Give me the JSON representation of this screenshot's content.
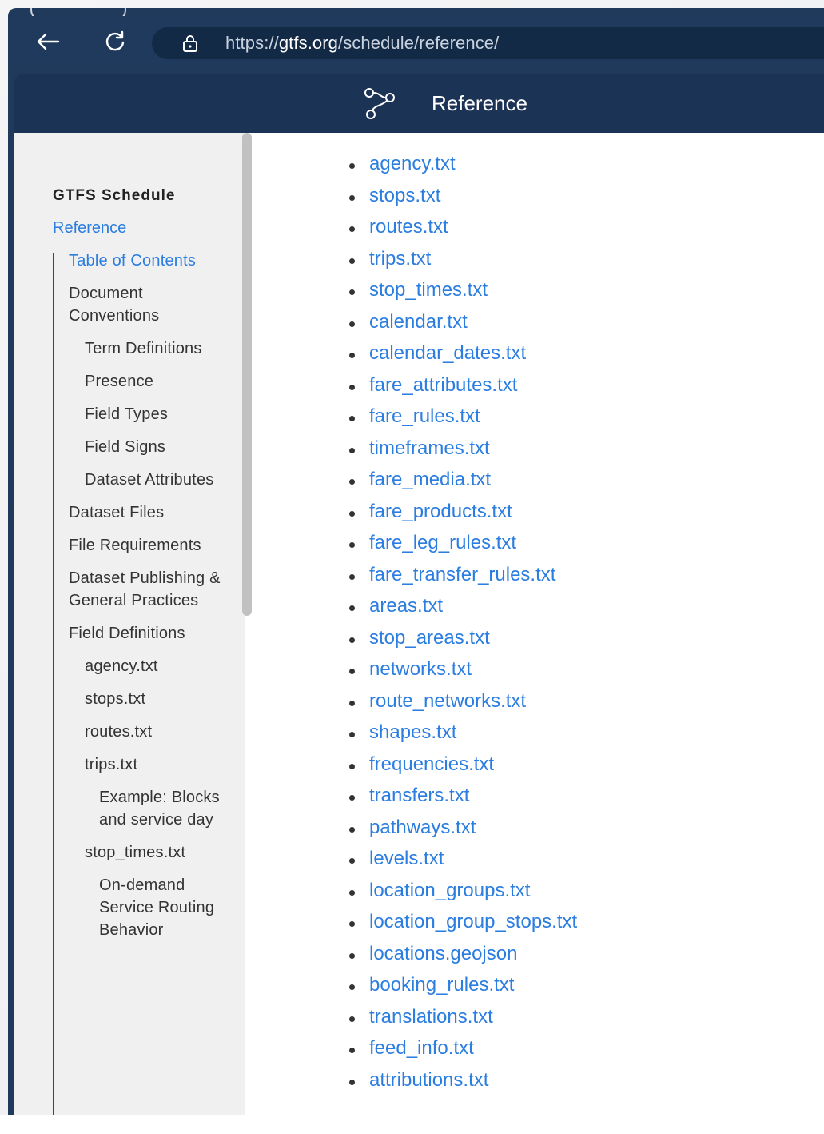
{
  "browser": {
    "url_prefix": "https://",
    "url_host": "gtfs.org",
    "url_path": "/schedule/reference/"
  },
  "header": {
    "title": "Reference"
  },
  "sidebar": {
    "heading": "GTFS Schedule",
    "reference_link": "Reference",
    "items": [
      {
        "label": "Table of Contents",
        "level": 1,
        "active": true
      },
      {
        "label": "Document Conventions",
        "level": 1
      },
      {
        "label": "Term Definitions",
        "level": 2
      },
      {
        "label": "Presence",
        "level": 2
      },
      {
        "label": "Field Types",
        "level": 2
      },
      {
        "label": "Field Signs",
        "level": 2
      },
      {
        "label": "Dataset Attributes",
        "level": 2
      },
      {
        "label": "Dataset Files",
        "level": 1
      },
      {
        "label": "File Requirements",
        "level": 1
      },
      {
        "label": "Dataset Publishing & General Practices",
        "level": 1
      },
      {
        "label": "Field Definitions",
        "level": 1
      },
      {
        "label": "agency.txt",
        "level": 2
      },
      {
        "label": "stops.txt",
        "level": 2
      },
      {
        "label": "routes.txt",
        "level": 2
      },
      {
        "label": "trips.txt",
        "level": 2
      },
      {
        "label": "Example: Blocks and service day",
        "level": 3
      },
      {
        "label": "stop_times.txt",
        "level": 2
      },
      {
        "label": "On-demand Service Routing Behavior",
        "level": 3
      }
    ]
  },
  "main": {
    "files": [
      "agency.txt",
      "stops.txt",
      "routes.txt",
      "trips.txt",
      "stop_times.txt",
      "calendar.txt",
      "calendar_dates.txt",
      "fare_attributes.txt",
      "fare_rules.txt",
      "timeframes.txt",
      "fare_media.txt",
      "fare_products.txt",
      "fare_leg_rules.txt",
      "fare_transfer_rules.txt",
      "areas.txt",
      "stop_areas.txt",
      "networks.txt",
      "route_networks.txt",
      "shapes.txt",
      "frequencies.txt",
      "transfers.txt",
      "pathways.txt",
      "levels.txt",
      "location_groups.txt",
      "location_group_stops.txt",
      "locations.geojson",
      "booking_rules.txt",
      "translations.txt",
      "feed_info.txt",
      "attributions.txt"
    ]
  },
  "colors": {
    "header_bg": "#1b3355",
    "browser_bg": "#1f3a5d",
    "link": "#2b7de0",
    "sidebar_bg": "#f0f0f0"
  },
  "icons": {
    "back": "arrow-left-icon",
    "reload": "reload-icon",
    "lock": "lock-icon",
    "logo": "gtfs-route-logo-icon"
  }
}
